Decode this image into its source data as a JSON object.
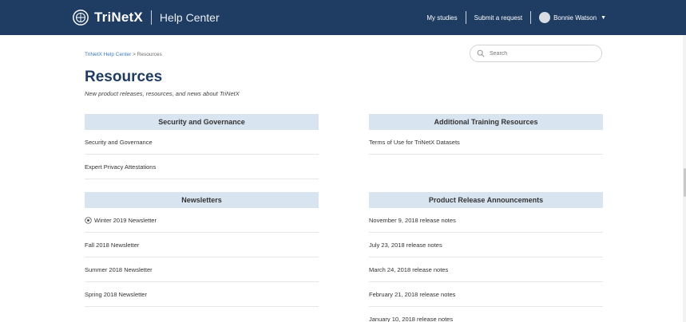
{
  "header": {
    "brand_name": "TriNetX",
    "brand_sub": "Help Center",
    "nav": {
      "my_studies": "My studies",
      "submit_request": "Submit a request",
      "user_name": "Bonnie Watson"
    },
    "logo_icon": "trinetx-logo-icon",
    "caret_icon": "chevron-down-icon"
  },
  "breadcrumb": {
    "home": "TriNetX Help Center",
    "separator": ">",
    "current": "Resources"
  },
  "search": {
    "placeholder": "Search"
  },
  "page": {
    "title": "Resources",
    "subtitle": "New product releases, resources, and news about TriNetX"
  },
  "sections": {
    "security": {
      "title": "Security and Governance",
      "items": [
        "Security and Governance",
        "Expert Privacy Attestations"
      ]
    },
    "training": {
      "title": "Additional Training Resources",
      "items": [
        "Terms of Use for TriNetX Datasets"
      ]
    },
    "newsletters": {
      "title": "Newsletters",
      "items": [
        "Winter 2019 Newsletter",
        "Fall 2018 Newsletter",
        "Summer 2018 Newsletter",
        "Spring 2018 Newsletter"
      ]
    },
    "releases": {
      "title": "Product Release Announcements",
      "items": [
        "November 9, 2018 release notes",
        "July 23, 2018 release notes",
        "March 24, 2018 release notes",
        "February 21, 2018 release notes",
        "January 10, 2018 release notes"
      ]
    }
  },
  "colors": {
    "header_bg": "#1f3c63",
    "section_head_bg": "#d9e4f1",
    "title": "#1f3c63",
    "link": "#3c7bbd"
  }
}
